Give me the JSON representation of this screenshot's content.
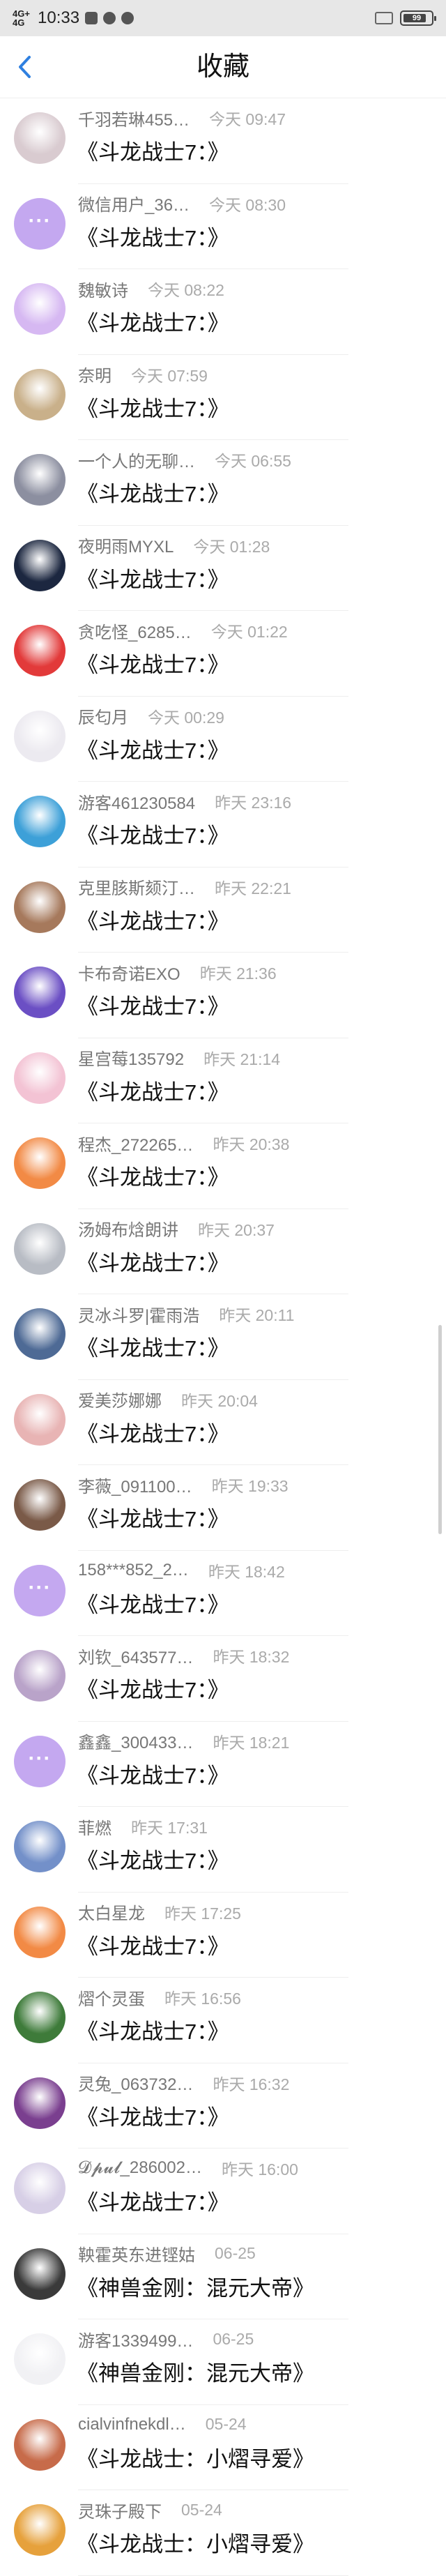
{
  "status_bar": {
    "network": "4G+ 4G",
    "time": "10:33",
    "battery": "99"
  },
  "header": {
    "back_icon": "chevron-left-icon",
    "title": "收藏",
    "accent_color": "#2f80e0"
  },
  "items": [
    {
      "name": "千羽若琳455…",
      "time": "今天 09:47",
      "message": "《斗龙战士7：》",
      "avatar": "anime-girl",
      "color": "#d9cbd0"
    },
    {
      "name": "微信用户_36…",
      "time": "今天 08:30",
      "message": "《斗龙战士7：》",
      "avatar": "default",
      "color": "#c4a8f0"
    },
    {
      "name": "魏敏诗",
      "time": "今天 08:22",
      "message": "《斗龙战士7：》",
      "avatar": "purple-blur",
      "color": "#d6b8f2"
    },
    {
      "name": "奈明",
      "time": "今天 07:59",
      "message": "《斗龙战士7：》",
      "avatar": "anime-boy",
      "color": "#c9b08a"
    },
    {
      "name": "一个人的无聊…",
      "time": "今天 06:55",
      "message": "《斗龙战士7：》",
      "avatar": "anime-character",
      "color": "#8c8fa0"
    },
    {
      "name": "夜明雨MYXL",
      "time": "今天 01:28",
      "message": "《斗龙战士7：》",
      "avatar": "dark-night",
      "color": "#1c2740"
    },
    {
      "name": "贪吃怪_6285…",
      "time": "今天 01:22",
      "message": "《斗龙战士7：》",
      "avatar": "red-monster",
      "color": "#e23a3a"
    },
    {
      "name": "辰匂月",
      "time": "今天 00:29",
      "message": "《斗龙战士7：》",
      "avatar": "sketch",
      "color": "#eceaf0"
    },
    {
      "name": "游客461230584",
      "time": "昨天 23:16",
      "message": "《斗龙战士7：》",
      "avatar": "blue-pattern",
      "color": "#3da0d8"
    },
    {
      "name": "克里胲斯颏汀…",
      "time": "昨天 22:21",
      "message": "《斗龙战士7：》",
      "avatar": "anime-boy",
      "color": "#a6795c"
    },
    {
      "name": "卡布奇诺EXO",
      "time": "昨天 21:36",
      "message": "《斗龙战士7：》",
      "avatar": "purple-galaxy",
      "color": "#6b4fc4"
    },
    {
      "name": "星宫莓135792",
      "time": "昨天 21:14",
      "message": "《斗龙战士7：》",
      "avatar": "anime-girl",
      "color": "#f3c3d4"
    },
    {
      "name": "程杰_272265…",
      "time": "昨天 20:38",
      "message": "《斗龙战士7：》",
      "avatar": "orange-cartoon",
      "color": "#f28a45"
    },
    {
      "name": "汤姆布焓朗讲",
      "time": "昨天 20:37",
      "message": "《斗龙战士7：》",
      "avatar": "sketch",
      "color": "#b8bcc4"
    },
    {
      "name": "灵冰斗罗|霍雨浩",
      "time": "昨天 20:11",
      "message": "《斗龙战士7：》",
      "avatar": "blue-anime",
      "color": "#4e6a95"
    },
    {
      "name": "爱美莎娜娜",
      "time": "昨天 20:04",
      "message": "《斗龙战士7：》",
      "avatar": "pink-pattern",
      "color": "#e8b4b4"
    },
    {
      "name": "李薇_091100…",
      "time": "昨天 19:33",
      "message": "《斗龙战士7：》",
      "avatar": "photo",
      "color": "#7a5a48"
    },
    {
      "name": "158***852_2…",
      "time": "昨天 18:42",
      "message": "《斗龙战士7：》",
      "avatar": "default",
      "color": "#c4a8f0"
    },
    {
      "name": "刘钦_643577…",
      "time": "昨天 18:32",
      "message": "《斗龙战士7：》",
      "avatar": "anime-girl",
      "color": "#b9a3c9"
    },
    {
      "name": "鑫鑫_300433…",
      "time": "昨天 18:21",
      "message": "《斗龙战士7：》",
      "avatar": "default",
      "color": "#c4a8f0"
    },
    {
      "name": "菲燃",
      "time": "昨天 17:31",
      "message": "《斗龙战士7：》",
      "avatar": "blue-anime",
      "color": "#7390c9"
    },
    {
      "name": "太白星龙",
      "time": "昨天 17:25",
      "message": "《斗龙战士7：》",
      "avatar": "orange-cartoon",
      "color": "#f28a45"
    },
    {
      "name": "熠个灵蛋",
      "time": "昨天 16:56",
      "message": "《斗龙战士7：》",
      "avatar": "green-red",
      "color": "#3e7b3a"
    },
    {
      "name": "灵兔_063732…",
      "time": "昨天 16:32",
      "message": "《斗龙战士7：》",
      "avatar": "purple-anime",
      "color": "#7a3f8f"
    },
    {
      "name": "𝓓𝓹𝓾𝓵_286002…",
      "time": "昨天 16:00",
      "message": "《斗龙战士7：》",
      "avatar": "anime-girl",
      "color": "#d7cfe6"
    },
    {
      "name": "鞅霍英东进铿姑",
      "time": "06-25",
      "message": "《神兽金刚：混元大帝》",
      "avatar": "dark-photo",
      "color": "#3a3a3a"
    },
    {
      "name": "游客1339499…",
      "time": "06-25",
      "message": "《神兽金刚：混元大帝》",
      "avatar": "white-cat",
      "color": "#f1f1f4"
    },
    {
      "name": "cialvinfnekdl…",
      "time": "05-24",
      "message": "《斗龙战士：小熠寻爱》",
      "avatar": "cartoon-face",
      "color": "#c76b4a"
    },
    {
      "name": "灵珠子殿下",
      "time": "05-24",
      "message": "《斗龙战士：小熠寻爱》",
      "avatar": "orange-character",
      "color": "#e6a13c"
    }
  ]
}
